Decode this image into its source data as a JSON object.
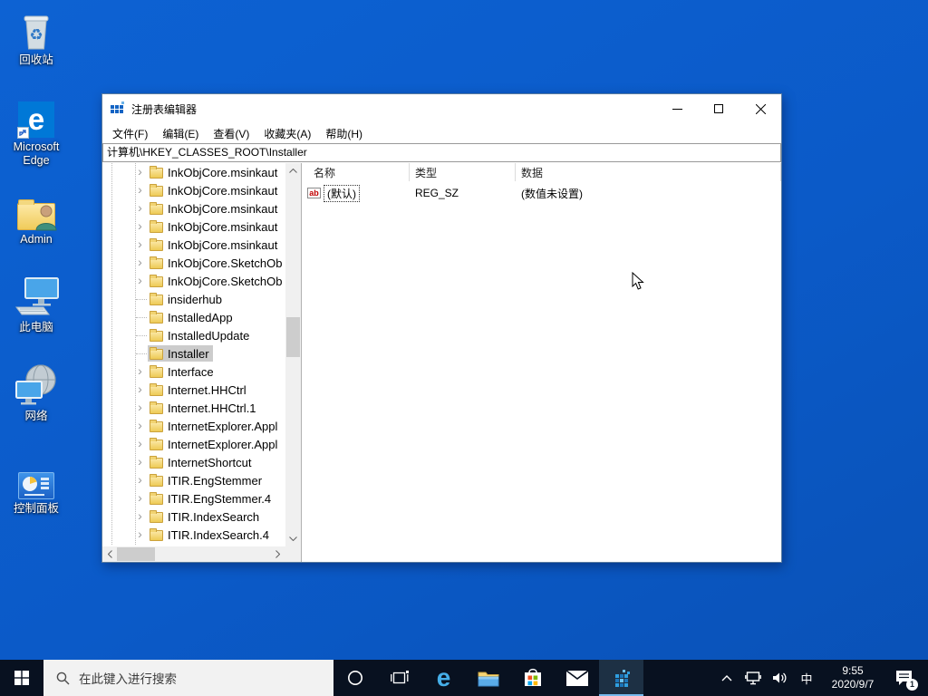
{
  "desktop": {
    "icons": [
      {
        "label": "回收站"
      },
      {
        "label": "Microsoft Edge"
      },
      {
        "label": "Admin"
      },
      {
        "label": "此电脑"
      },
      {
        "label": "网络"
      },
      {
        "label": "控制面板"
      }
    ]
  },
  "window": {
    "title": "注册表编辑器",
    "menu_items": [
      "文件(F)",
      "编辑(E)",
      "查看(V)",
      "收藏夹(A)",
      "帮助(H)"
    ],
    "address": "计算机\\HKEY_CLASSES_ROOT\\Installer",
    "tree_items": [
      {
        "label": "InkObjCore.msinkaut",
        "expandable": true,
        "selected": false
      },
      {
        "label": "InkObjCore.msinkaut",
        "expandable": true,
        "selected": false
      },
      {
        "label": "InkObjCore.msinkaut",
        "expandable": true,
        "selected": false
      },
      {
        "label": "InkObjCore.msinkaut",
        "expandable": true,
        "selected": false
      },
      {
        "label": "InkObjCore.msinkaut",
        "expandable": true,
        "selected": false
      },
      {
        "label": "InkObjCore.SketchOb",
        "expandable": true,
        "selected": false
      },
      {
        "label": "InkObjCore.SketchOb",
        "expandable": true,
        "selected": false
      },
      {
        "label": "insiderhub",
        "expandable": false,
        "selected": false
      },
      {
        "label": "InstalledApp",
        "expandable": false,
        "selected": false
      },
      {
        "label": "InstalledUpdate",
        "expandable": false,
        "selected": false
      },
      {
        "label": "Installer",
        "expandable": false,
        "selected": true
      },
      {
        "label": "Interface",
        "expandable": true,
        "selected": false
      },
      {
        "label": "Internet.HHCtrl",
        "expandable": true,
        "selected": false
      },
      {
        "label": "Internet.HHCtrl.1",
        "expandable": true,
        "selected": false
      },
      {
        "label": "InternetExplorer.Appl",
        "expandable": true,
        "selected": false
      },
      {
        "label": "InternetExplorer.Appl",
        "expandable": true,
        "selected": false
      },
      {
        "label": "InternetShortcut",
        "expandable": true,
        "selected": false
      },
      {
        "label": "ITIR.EngStemmer",
        "expandable": true,
        "selected": false
      },
      {
        "label": "ITIR.EngStemmer.4",
        "expandable": true,
        "selected": false
      },
      {
        "label": "ITIR.IndexSearch",
        "expandable": true,
        "selected": false
      },
      {
        "label": "ITIR.IndexSearch.4",
        "expandable": true,
        "selected": false
      }
    ],
    "list": {
      "columns": [
        "名称",
        "类型",
        "数据"
      ],
      "rows": [
        {
          "name": "(默认)",
          "type": "REG_SZ",
          "data": "(数值未设置)"
        }
      ]
    }
  },
  "icons": {
    "string_value_glyph": "ab"
  },
  "taskbar": {
    "search_placeholder": "在此键入进行搜索",
    "ime_indicator": "中",
    "clock": {
      "time": "9:55",
      "date": "2020/9/7"
    },
    "notification_badge": "1"
  },
  "colors": {
    "desktop": "#0b5ac8",
    "accent": "#0078d7",
    "taskbar": "#081120",
    "selection": "#cccccc",
    "active_underline": "#76b9ed"
  }
}
